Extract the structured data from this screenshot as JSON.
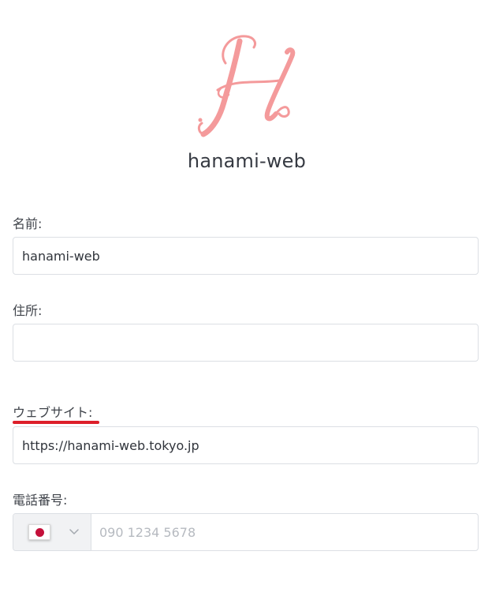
{
  "brand": {
    "logo_icon": "script-h-logo",
    "logo_letter": "H",
    "logo_color": "#f49a9b",
    "name": "hanami-web"
  },
  "form": {
    "name_label": "名前:",
    "name_value": "hanami-web",
    "address_label": "住所:",
    "address_value": "",
    "website_label": "ウェブサイト:",
    "website_value": "https://hanami-web.tokyo.jp",
    "phone_label": "電話番号:",
    "phone_country_icon": "japan-flag-icon",
    "phone_placeholder": "090 1234 5678",
    "phone_value": ""
  },
  "highlight_color": "#dd1f2a"
}
